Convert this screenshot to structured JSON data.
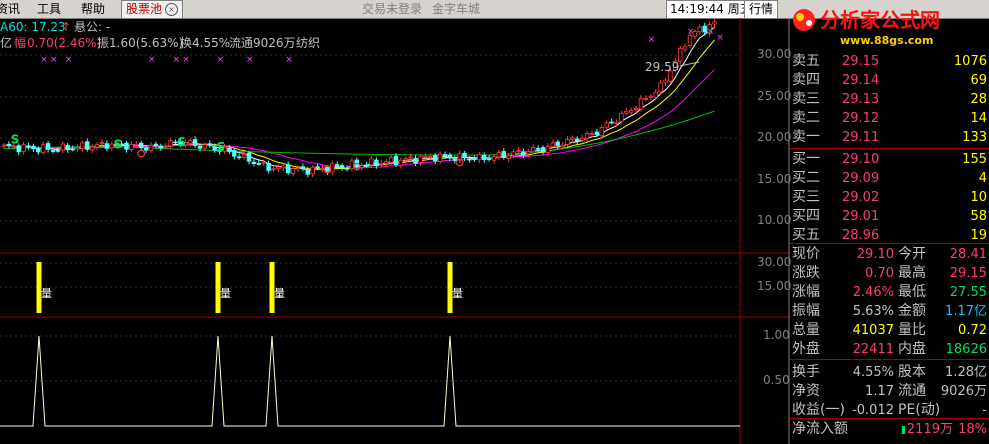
{
  "menu": {
    "items": [
      "资讯",
      "工具",
      "帮助"
    ],
    "pool_label": "股票池",
    "pool_close_glyph": "×",
    "center_links": [
      "交易未登录",
      "金字车城"
    ],
    "clock": "14:19:44 周五",
    "market_button": "行情"
  },
  "logo": {
    "text": "分析家公式网",
    "url": "www.88gs.com"
  },
  "info": {
    "ma60": "A60: 17.23",
    "up_arrow": "↑",
    "formula_label": "悬公: -",
    "yi": "亿",
    "change_label": "幅",
    "change_value": "0.70(2.46%)",
    "amplitude": "振1.60(5.63%)",
    "turnover": "换4.55%",
    "float": "流通9026万",
    "industry": "纺织"
  },
  "chart_labels": {
    "peak": "29.59",
    "main_axis": [
      "30.00",
      "25.00",
      "20.00",
      "15.00",
      "10.00"
    ],
    "vol_axis": [
      "30.00",
      "15.00"
    ],
    "ind_axis": [
      "1.00",
      "0.50"
    ],
    "signal_char": "S",
    "vol_signal_char": "量",
    "x_mark": "×"
  },
  "quote": {
    "sell": [
      {
        "label": "卖五",
        "price": "29.15",
        "vol": "1076"
      },
      {
        "label": "卖四",
        "price": "29.14",
        "vol": "69"
      },
      {
        "label": "卖三",
        "price": "29.13",
        "vol": "28"
      },
      {
        "label": "卖二",
        "price": "29.12",
        "vol": "14"
      },
      {
        "label": "卖一",
        "price": "29.11",
        "vol": "133"
      }
    ],
    "buy": [
      {
        "label": "买一",
        "price": "29.10",
        "vol": "155"
      },
      {
        "label": "买二",
        "price": "29.09",
        "vol": "4"
      },
      {
        "label": "买三",
        "price": "29.02",
        "vol": "10"
      },
      {
        "label": "买四",
        "price": "29.01",
        "vol": "58"
      },
      {
        "label": "买五",
        "price": "28.96",
        "vol": "19"
      }
    ],
    "stats": [
      {
        "l1": "现价",
        "v1": "29.10",
        "c1": "#ff3c6e",
        "l2": "今开",
        "v2": "28.41",
        "c2": "#ff3c6e"
      },
      {
        "l1": "涨跌",
        "v1": "0.70",
        "c1": "#ff3c6e",
        "l2": "最高",
        "v2": "29.15",
        "c2": "#ff3c6e"
      },
      {
        "l1": "涨幅",
        "v1": "2.46%",
        "c1": "#ff3c6e",
        "l2": "最低",
        "v2": "27.55",
        "c2": "#00e060"
      },
      {
        "l1": "振幅",
        "v1": "5.63%",
        "c1": "#c0c0c0",
        "l2": "金额",
        "v2": "1.17亿",
        "c2": "#00c8ff"
      },
      {
        "l1": "总量",
        "v1": "41037",
        "c1": "#ffff00",
        "l2": "量比",
        "v2": "0.72",
        "c2": "#ffff00"
      },
      {
        "l1": "外盘",
        "v1": "22411",
        "c1": "#ff3c6e",
        "l2": "内盘",
        "v2": "18626",
        "c2": "#00e060"
      },
      {
        "l1": "换手",
        "v1": "4.55%",
        "c1": "#c0c0c0",
        "l2": "股本",
        "v2": "1.28亿",
        "c2": "#c0c0c0"
      },
      {
        "l1": "净资",
        "v1": "1.17",
        "c1": "#c0c0c0",
        "l2": "流通",
        "v2": "9026万",
        "c2": "#c0c0c0"
      },
      {
        "l1": "收益(一)",
        "v1": "-0.012",
        "c1": "#c0c0c0",
        "l2": "PE(动)",
        "v2": "-",
        "c2": "#c0c0c0"
      }
    ],
    "netflow": {
      "label": "净流入额",
      "value": "2119万",
      "pct": "18%"
    }
  },
  "colors": {
    "up": "#ff3c3c",
    "down": "#54ffff",
    "ma_white": "#ffffff",
    "ma_yellow": "#ffff00",
    "ma_magenta": "#ff00ff",
    "ma_green": "#00c000",
    "signal": "#ffff00"
  }
}
